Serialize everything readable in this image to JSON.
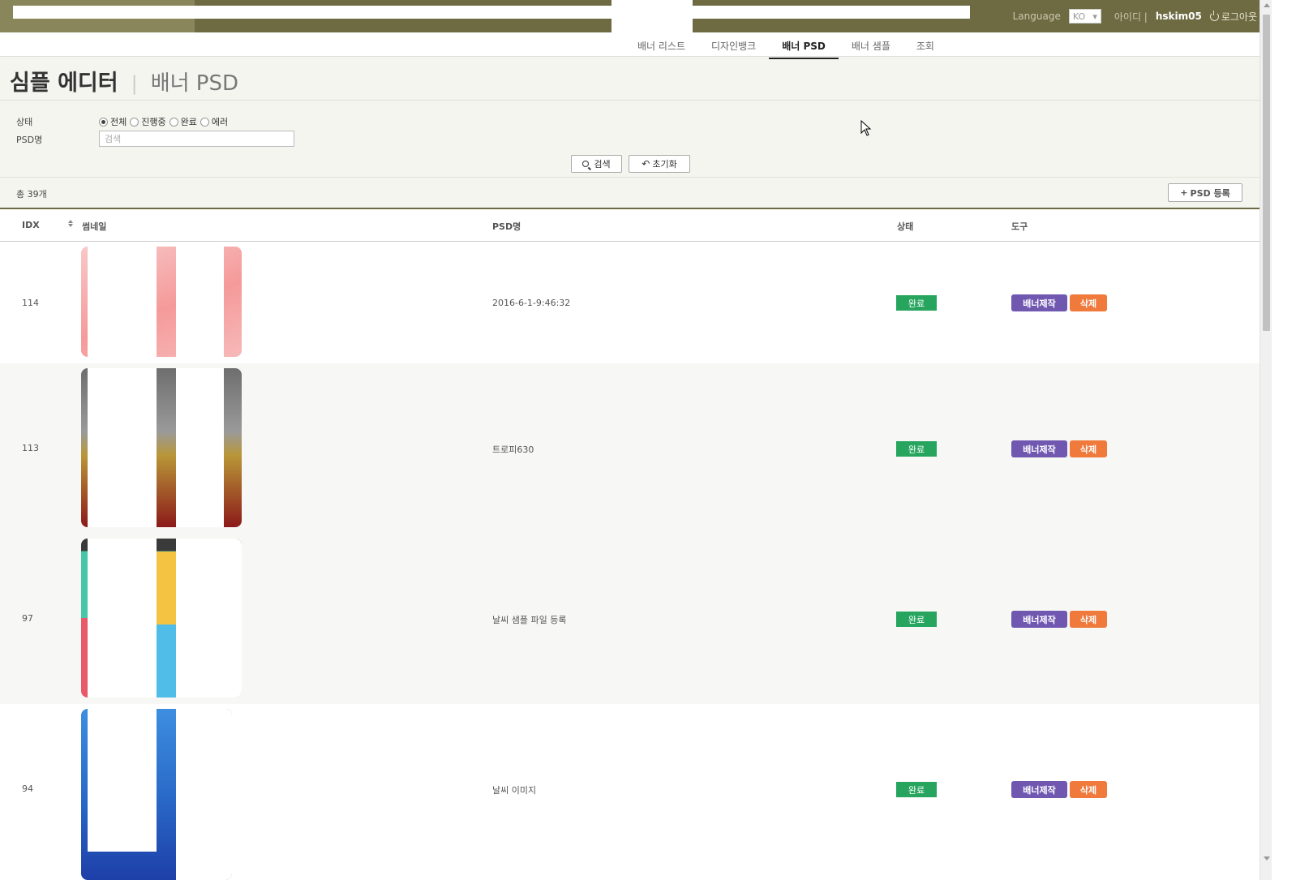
{
  "topbar": {
    "language_label": "Language",
    "language_value": "KO",
    "id_label": "아이디 |",
    "user_id": "hskim05",
    "logout_label": "로그아웃"
  },
  "subnav": {
    "items": [
      {
        "label": "배너 리스트",
        "active": false
      },
      {
        "label": "디자인뱅크",
        "active": false
      },
      {
        "label": "배너 PSD",
        "active": true
      },
      {
        "label": "배너 샘플",
        "active": false
      },
      {
        "label": "조회",
        "active": false
      }
    ]
  },
  "page": {
    "title": "심플 에디터",
    "subtitle": "배너 PSD"
  },
  "filter": {
    "status_label": "상태",
    "status_options": [
      {
        "label": "전체",
        "checked": true
      },
      {
        "label": "진행중",
        "checked": false
      },
      {
        "label": "완료",
        "checked": false
      },
      {
        "label": "에러",
        "checked": false
      }
    ],
    "psd_label": "PSD명",
    "search_placeholder": "검색",
    "search_button": "검색",
    "reset_button": "초기화"
  },
  "list": {
    "total": "총 39개",
    "register_button": "PSD 등록",
    "columns": {
      "idx": "IDX",
      "thumb": "썸네일",
      "psd": "PSD명",
      "status": "상태",
      "tools": "도구"
    },
    "rows": [
      {
        "idx": "114",
        "psd": "2016-6-1-9:46:32",
        "status": "완료",
        "make": "배너제작",
        "delete": "삭제"
      },
      {
        "idx": "113",
        "psd": "트로피630",
        "status": "완료",
        "make": "배너제작",
        "delete": "삭제"
      },
      {
        "idx": "97",
        "psd": "날씨 샘플 파일 등록",
        "status": "완료",
        "make": "배너제작",
        "delete": "삭제"
      },
      {
        "idx": "94",
        "psd": "날씨 이미지",
        "status": "완료",
        "make": "배너제작",
        "delete": "삭제"
      }
    ]
  },
  "colors": {
    "topbar": "#6e6b43",
    "status_done": "#27a55f",
    "make_button": "#7058b1",
    "delete_button": "#ef7a3c"
  }
}
